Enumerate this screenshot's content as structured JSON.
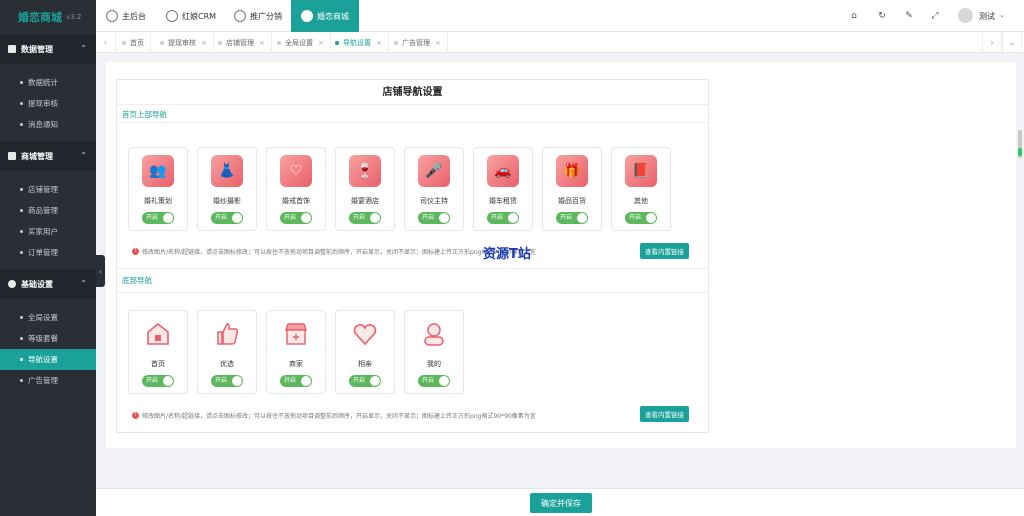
{
  "app": {
    "title": "婚恋商城",
    "version": "v3.2"
  },
  "sidebar": {
    "groups": [
      {
        "label": "数据管理",
        "items": [
          "数据统计",
          "提现审核",
          "消息通知"
        ]
      },
      {
        "label": "商城管理",
        "items": [
          "店铺管理",
          "商品管理",
          "买家用户",
          "订单管理"
        ]
      },
      {
        "label": "基础设置",
        "items": [
          "全局设置",
          "等级套餐",
          "导航设置",
          "广告管理"
        ],
        "active_item": "导航设置"
      }
    ]
  },
  "topbar": {
    "tabs": [
      "主后台",
      "红娘CRM",
      "推广分销",
      "婚恋商城"
    ],
    "active_tab": "婚恋商城",
    "user": "测试"
  },
  "tabstrip": {
    "tabs": [
      "首页",
      "提现审核",
      "店铺管理",
      "全局设置",
      "导航设置",
      "广告管理"
    ],
    "active": "导航设置"
  },
  "panel": {
    "title": "店铺导航设置",
    "top_section_label": "首页上部导航",
    "top_items": [
      "婚礼策划",
      "婚纱摄影",
      "婚戒首饰",
      "婚宴酒店",
      "司仪主持",
      "婚车租赁",
      "婚品百货",
      "其他"
    ],
    "bottom_section_label": "底部导航",
    "bottom_items": [
      "首页",
      "优选",
      "商家",
      "相亲",
      "我的"
    ],
    "toggle_label": "开启",
    "hint_top": "修改图片/名称/超链接，请点击图标修改；可以按住不放拖动项目调整前后顺序，开启显示，关闭不显示；图标建上传正方形png格式90*90像素为宜",
    "hint_bottom": "修改图片/名称/超链接，请点击图标修改；可以按住不放拖动项目调整前后顺序，开启显示，关闭不显示；图标建上传正方形png格式90*90像素为宜",
    "link_button": "查看内置链接",
    "watermark": "资源T站"
  },
  "footer": {
    "save_button": "确定并保存"
  },
  "colors": {
    "accent": "#1aa29a",
    "toggle_on": "#5cb85c",
    "icon_gradient_start": "#f8a1a1",
    "icon_gradient_end": "#e9606a"
  }
}
